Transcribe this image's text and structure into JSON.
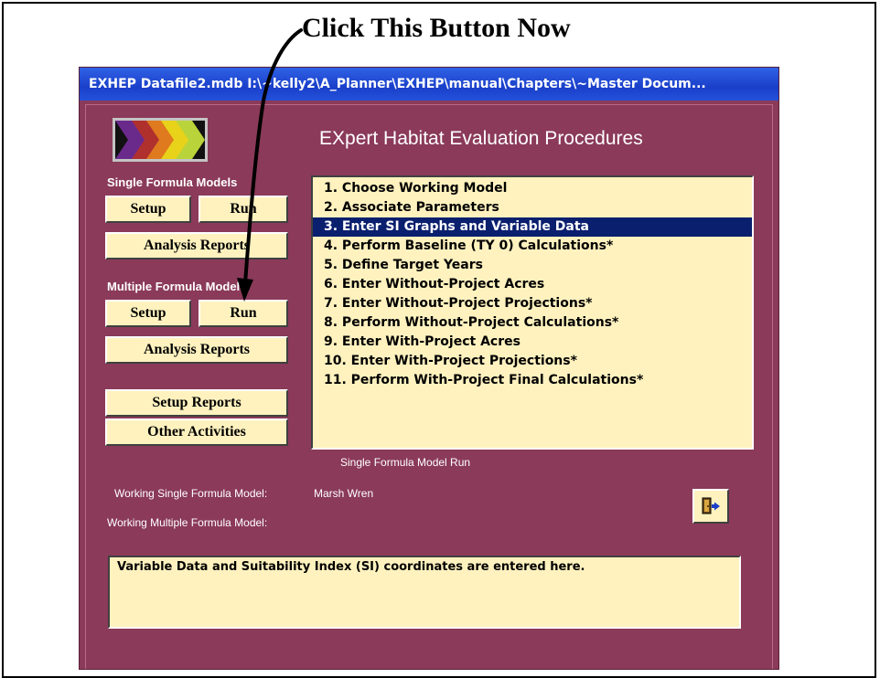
{
  "annotation": {
    "text": "Click This Button Now"
  },
  "window": {
    "title": "EXHEP    Datafile2.mdb    I:\\~kelly2\\A_Planner\\EXHEP\\manual\\Chapters\\~Master Docum..."
  },
  "app": {
    "title": "EXpert Habitat Evaluation Procedures",
    "logo_icon": "chevron-arrows-logo"
  },
  "single_formula": {
    "label": "Single Formula Models",
    "setup": "Setup",
    "run": "Run",
    "analysis": "Analysis Reports"
  },
  "multiple_formula": {
    "label": "Multiple Formula Models",
    "setup": "Setup",
    "run": "Run",
    "analysis": "Analysis Reports"
  },
  "setup_reports": "Setup Reports",
  "other_activities": "Other Activities",
  "steps": [
    "1.  Choose Working Model",
    "2.  Associate Parameters",
    "3.  Enter SI Graphs and Variable Data",
    "4.  Perform Baseline (TY 0) Calculations*",
    "5.  Define Target Years",
    "6.  Enter Without-Project Acres",
    "7.  Enter Without-Project Projections*",
    "8.  Perform Without-Project Calculations*",
    "9.  Enter With-Project Acres",
    "10. Enter With-Project Projections*",
    "11. Perform With-Project Final Calculations*"
  ],
  "selected_step": 2,
  "status": {
    "mode": "Single Formula Model Run",
    "single_label": "Working Single Formula Model:",
    "single_value": "Marsh Wren",
    "multiple_label": "Working Multiple Formula Model:",
    "multiple_value": ""
  },
  "exit_icon": "exit-door-icon",
  "info": "Variable Data and Suitability Index (SI) coordinates are entered here.",
  "colors": {
    "window_bg": "#8b3a59",
    "panel_bg": "#fff2bf",
    "selection": "#0a1f6e",
    "titlebar": "#1f4fd6"
  }
}
